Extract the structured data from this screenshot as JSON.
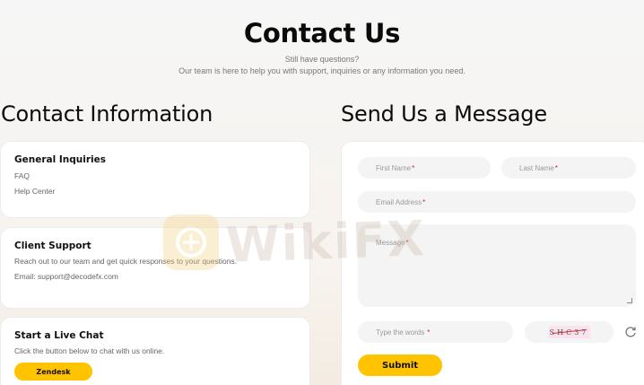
{
  "hero": {
    "title": "Contact Us",
    "subtitle": "Still have questions?",
    "description": "Our team is here to help you with support, inquiries or any information you need."
  },
  "contact_info": {
    "title": "Contact Information",
    "cards": [
      {
        "title": "General Inquiries",
        "lines": [
          "FAQ",
          "Help Center"
        ]
      },
      {
        "title": "Client Support",
        "lines": [
          "Reach out to our team and get quick responses to your questions.",
          "Email: support@decodefx.com"
        ]
      },
      {
        "title": "Start a Live Chat",
        "lines": [
          "Click the button below to chat with us online."
        ],
        "button": "Zendesk"
      }
    ]
  },
  "form": {
    "title": "Send Us a Message",
    "first_name": "First Name",
    "last_name": "Last Name",
    "email": "Email Address",
    "message": "Message",
    "captcha_prompt": "Type the words",
    "captcha_text": "SHC37",
    "required_mark": "*",
    "submit": "Submit"
  },
  "watermark": {
    "text": "WikiFX"
  },
  "colors": {
    "accent": "#ffc300",
    "required": "#d8232a"
  },
  "icons": {
    "refresh": "refresh-icon"
  }
}
